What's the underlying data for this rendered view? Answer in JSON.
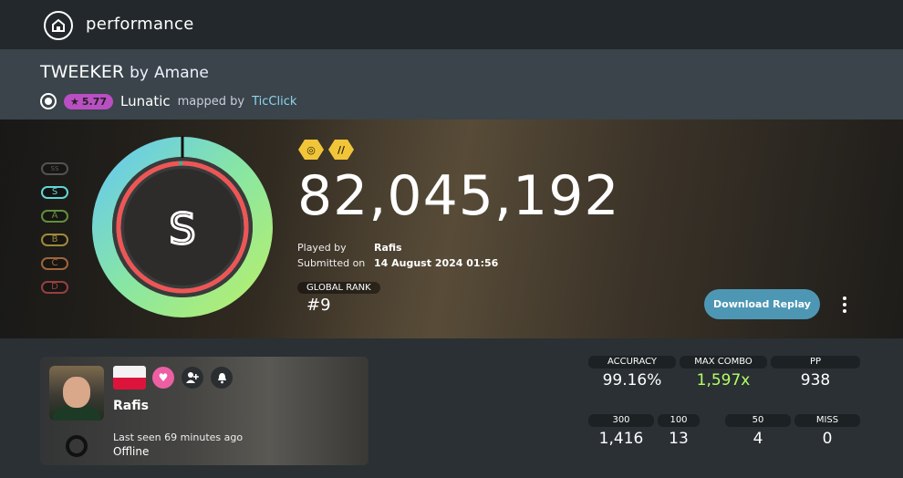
{
  "header": {
    "title": "performance",
    "logo_icon": "home-icon"
  },
  "beatmap": {
    "title": "TWEEKER",
    "artist_prefix": "by",
    "artist": "Amane",
    "star_rating": "5.77",
    "difficulty": "Lunatic",
    "mapped_by_label": "mapped by",
    "mapper": "TicClick"
  },
  "grades": {
    "ss_label": "SS",
    "items": [
      {
        "label": "S",
        "color": "#5ed6d5"
      },
      {
        "label": "A",
        "color": "#7fbf4d"
      },
      {
        "label": "B",
        "color": "#d8b84a"
      },
      {
        "label": "C",
        "color": "#d6844a"
      },
      {
        "label": "D",
        "color": "#c9504f"
      }
    ]
  },
  "score": {
    "grade": "S",
    "accuracy_fraction": 0.9916,
    "value": "82,045,192",
    "played_by_label": "Played by",
    "played_by": "Rafis",
    "submitted_label": "Submitted on",
    "submitted_on": "14 August 2024 01:56",
    "global_rank_label": "GLOBAL RANK",
    "global_rank": "#9",
    "download_label": "Download Replay",
    "mods": [
      "HD",
      "DT"
    ]
  },
  "player": {
    "name": "Rafis",
    "last_seen": "Last seen 69 minutes ago",
    "status": "Offline"
  },
  "stats": {
    "accuracy_label": "ACCURACY",
    "accuracy": "99.16%",
    "max_combo_label": "MAX COMBO",
    "max_combo": "1,597x",
    "pp_label": "PP",
    "pp": "938",
    "c300_label": "300",
    "c300": "1,416",
    "c100_label": "100",
    "c100": "13",
    "c50_label": "50",
    "c50": "4",
    "miss_label": "MISS",
    "miss": "0"
  },
  "colors": {
    "accent": "#4e97b4",
    "star_badge": "#b94fc3",
    "combo": "#b3ff66",
    "mapper_link": "#8fd6f0"
  }
}
